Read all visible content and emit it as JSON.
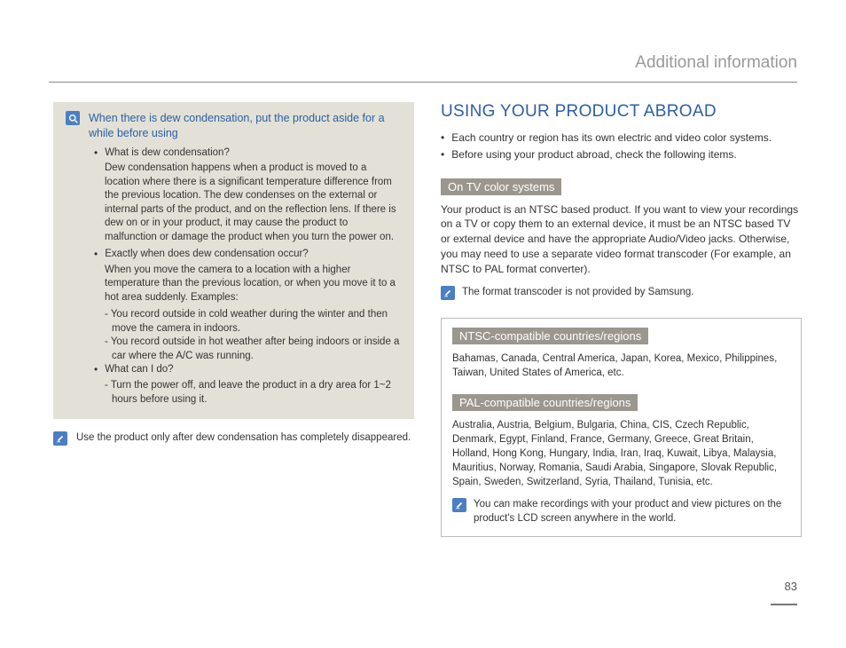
{
  "chapter": "Additional information",
  "page_number": "83",
  "left": {
    "callout_title": "When there is dew condensation, put the product aside for a while before using",
    "q1": "What is dew condensation?",
    "p1": "Dew condensation happens when a product is moved to a location where there is a significant temperature difference from the previous location. The dew condenses on the external or internal parts of the product, and on the reflection lens. If there is dew on or in your product, it may cause the product to malfunction or damage the product when you turn the power on.",
    "q2": "Exactly when does dew condensation occur?",
    "p2": "When you move the camera to a location with a higher temperature than the previous location, or when you move it to a hot area suddenly. Examples:",
    "d1": "- You record outside in cold weather during the winter and then move the camera in indoors.",
    "d2": "- You record outside in hot weather after being indoors or inside a car where the A/C was running.",
    "q3": "What can I do?",
    "d3": "- Turn the power off, and leave the product in a dry area for 1~2 hours before using it.",
    "note": "Use the product only after dew condensation has completely disappeared."
  },
  "right": {
    "heading": "USING YOUR PRODUCT ABROAD",
    "b1": "Each country or region has its own electric and video color systems.",
    "b2": "Before using your product abroad, check the following items.",
    "sub1": "On TV color systems",
    "p1": "Your product is an NTSC based product. If you want to view your recordings on a TV or copy them to an external device, it must be an NTSC based TV or external device and have the appropriate Audio/Video jacks. Otherwise, you may need to use a separate video format transcoder (For example, an NTSC to PAL format converter).",
    "note1": "The format transcoder is not provided by Samsung.",
    "sub2": "NTSC-compatible countries/regions",
    "p2": "Bahamas, Canada, Central America, Japan, Korea, Mexico, Philippines, Taiwan, United States of America, etc.",
    "sub3": "PAL-compatible countries/regions",
    "p3": "Australia, Austria, Belgium, Bulgaria, China, CIS, Czech Republic, Denmark, Egypt, Finland, France, Germany, Greece, Great Britain, Holland, Hong Kong, Hungary, India, Iran, Iraq, Kuwait, Libya, Malaysia, Mauritius, Norway, Romania, Saudi Arabia, Singapore, Slovak Republic, Spain, Sweden, Switzerland, Syria, Thailand, Tunisia, etc.",
    "note2": "You can make recordings with your product and view pictures on the product's LCD screen anywhere in the world."
  }
}
